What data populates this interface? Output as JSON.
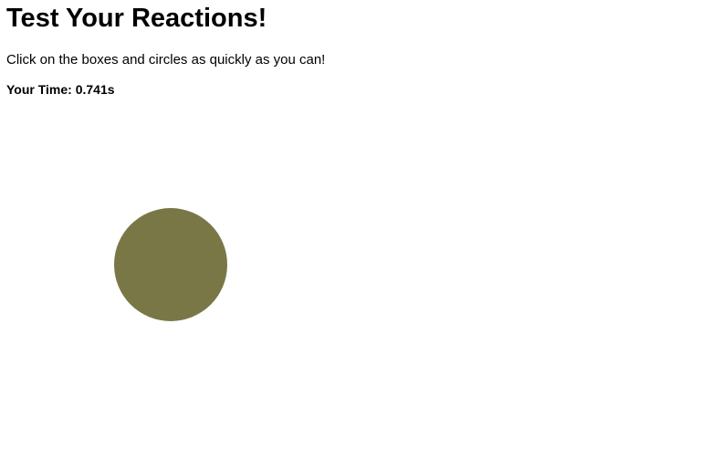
{
  "page": {
    "title": "Test Your Reactions!",
    "instructions": "Click on the boxes and circles as quickly as you can!",
    "time_label": "Your Time:",
    "time_value": "0.741s"
  },
  "target": {
    "shape": "circle",
    "color": "#7a7747"
  }
}
